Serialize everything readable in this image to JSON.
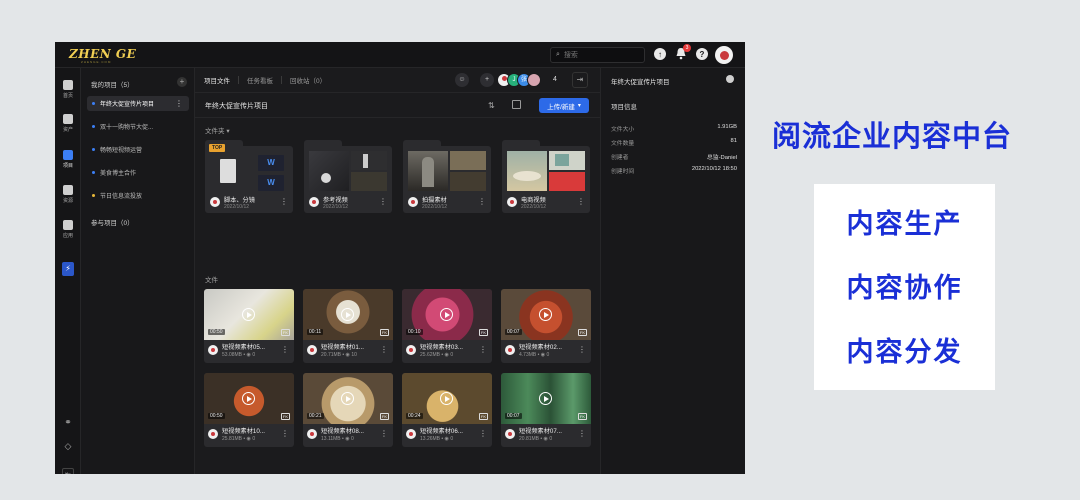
{
  "app": {
    "logo": "ZHEN GE",
    "logo_sub": "ZHENGE.COM"
  },
  "topbar": {
    "search_placeholder": "搜索",
    "notification_count": "3"
  },
  "rail": {
    "items": [
      {
        "label": "首页",
        "icon": "home-icon"
      },
      {
        "label": "资产",
        "icon": "box-icon"
      },
      {
        "label": "项目",
        "icon": "layers-icon"
      },
      {
        "label": "资源",
        "icon": "server-icon"
      },
      {
        "label": "应用",
        "icon": "apps-icon"
      }
    ]
  },
  "projects": {
    "my_projects_label": "我的项目（5）",
    "joined_projects_label": "参与项目（0）",
    "items": [
      {
        "name": "年终大促宣传片项目"
      },
      {
        "name": "双十一购物节大促..."
      },
      {
        "name": "畅畅短视频运营"
      },
      {
        "name": "美食博主合作"
      },
      {
        "name": "节日信息流投放"
      }
    ]
  },
  "tabs": [
    "项目文件",
    "任务看板",
    "回收站（0）"
  ],
  "members": [
    "",
    "J",
    "张",
    ""
  ],
  "member_count": "4",
  "main": {
    "title": "年终大促宣传片项目",
    "upload_label": "上传/新建",
    "folders_label": "文件夹",
    "files_label": "文件"
  },
  "folders": [
    {
      "name": "脚本、分镜",
      "date": "2022/10/12",
      "badge": "TOP"
    },
    {
      "name": "参考视频",
      "date": "2022/10/12"
    },
    {
      "name": "拍摄素材",
      "date": "2022/10/12"
    },
    {
      "name": "电商视频",
      "date": "2022/10/12"
    }
  ],
  "videos": [
    {
      "name": "短视频素材05...",
      "size": "53.08MB",
      "comments": "0",
      "duration": "00:50",
      "res": "FK"
    },
    {
      "name": "短视频素材01...",
      "size": "20.71MB",
      "comments": "10",
      "duration": "00:11",
      "res": "FK"
    },
    {
      "name": "短视频素材03...",
      "size": "25.62MB",
      "comments": "0",
      "duration": "00:10",
      "res": "FK"
    },
    {
      "name": "短视频素材02...",
      "size": "4.73MB",
      "comments": "0",
      "duration": "00:07",
      "res": "FK"
    },
    {
      "name": "短视频素材10...",
      "size": "25.81MB",
      "comments": "0",
      "duration": "00:50",
      "res": "FK"
    },
    {
      "name": "短视频素材08...",
      "size": "13.11MB",
      "comments": "0",
      "duration": "00:21",
      "res": "FK"
    },
    {
      "name": "短视频素材06...",
      "size": "13.26MB",
      "comments": "0",
      "duration": "00:24",
      "res": "FK"
    },
    {
      "name": "短视频素材07...",
      "size": "20.81MB",
      "comments": "0",
      "duration": "00:07",
      "res": "FK"
    }
  ],
  "info": {
    "title": "年终大促宣传片项目",
    "heading": "项目信息",
    "rows": [
      {
        "label": "文件大小",
        "value": "1.91GB"
      },
      {
        "label": "文件数量",
        "value": "81"
      },
      {
        "label": "创建者",
        "value": "总监-Daniel"
      },
      {
        "label": "创建时间",
        "value": "2022/10/12 18:50"
      }
    ]
  },
  "promo": {
    "title": "阅流企业内容中台",
    "items": [
      "内容生产",
      "内容协作",
      "内容分发"
    ]
  },
  "colors": {
    "accent": "#2d6ae8",
    "promo_blue": "#1a2fd6",
    "logo_gold": "#f1cf53",
    "top_badge": "#e9a22f"
  }
}
